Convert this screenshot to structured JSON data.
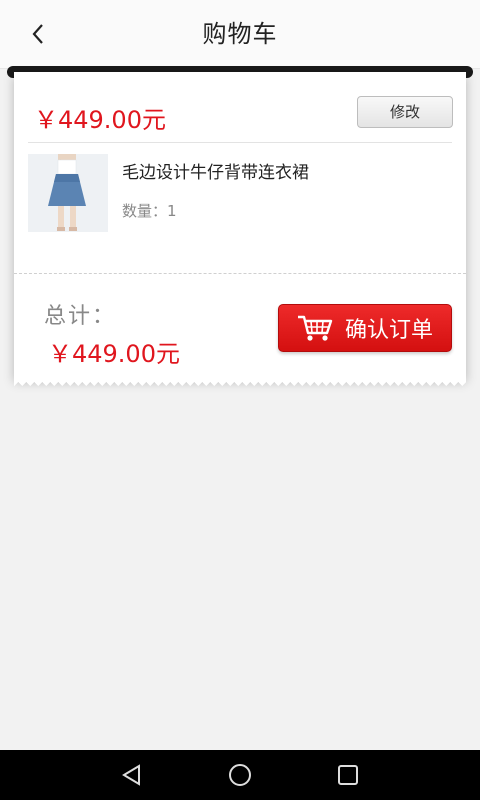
{
  "header": {
    "title": "购物车",
    "back_icon": "chevron-left-icon"
  },
  "order": {
    "price": "￥449.00元",
    "modify_label": "修改",
    "item": {
      "name": "毛边设计牛仔背带连衣裙",
      "quantity": "数量：1",
      "thumbnail_icon": "denim-dress-thumbnail"
    }
  },
  "footer": {
    "total_label": "总计：",
    "total_price": "￥449.00元",
    "confirm_label": "确认订单",
    "cart_icon": "shopping-cart-icon"
  },
  "navbar": {
    "back": "triangle-back-icon",
    "home": "circle-home-icon",
    "recents": "square-recents-icon"
  },
  "colors": {
    "accent": "#e0161e",
    "button": "#e41b1b"
  }
}
